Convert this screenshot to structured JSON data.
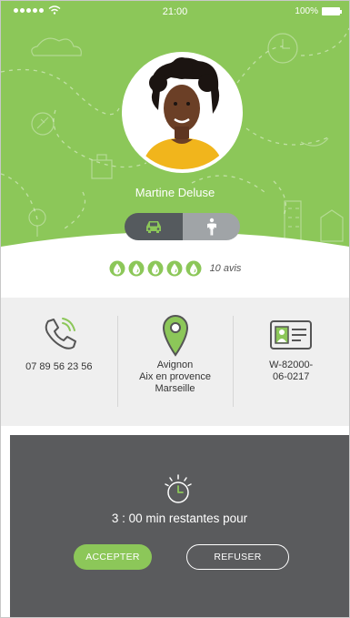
{
  "status_bar": {
    "time": "21:00",
    "battery": "100%"
  },
  "driver": {
    "name": "Martine Deluse"
  },
  "mode_toggle": {
    "options": [
      "car",
      "walk"
    ],
    "selected": "car"
  },
  "rating": {
    "value": 5,
    "max": 5,
    "reviews": "10 avis"
  },
  "info": {
    "phone": "07 89 56 23 56",
    "location": "Avignon\nAix en provence\nMarseille",
    "license": "W-82000-\n06-0217"
  },
  "request": {
    "countdown": "3 : 00 min restantes pour",
    "accept_label": "ACCEPTER",
    "refuse_label": "REFUSER"
  },
  "colors": {
    "brand_green": "#8cc759",
    "panel_dark": "#5a5b5d",
    "toggle_active": "#555a5e",
    "toggle_inactive": "#a0a4a7",
    "info_band": "#efefef"
  },
  "icons": [
    "wifi-icon",
    "battery-icon",
    "car-icon",
    "walking-person-icon",
    "drop-rating-icon",
    "phone-icon",
    "map-pin-icon",
    "id-card-icon",
    "timer-icon"
  ]
}
